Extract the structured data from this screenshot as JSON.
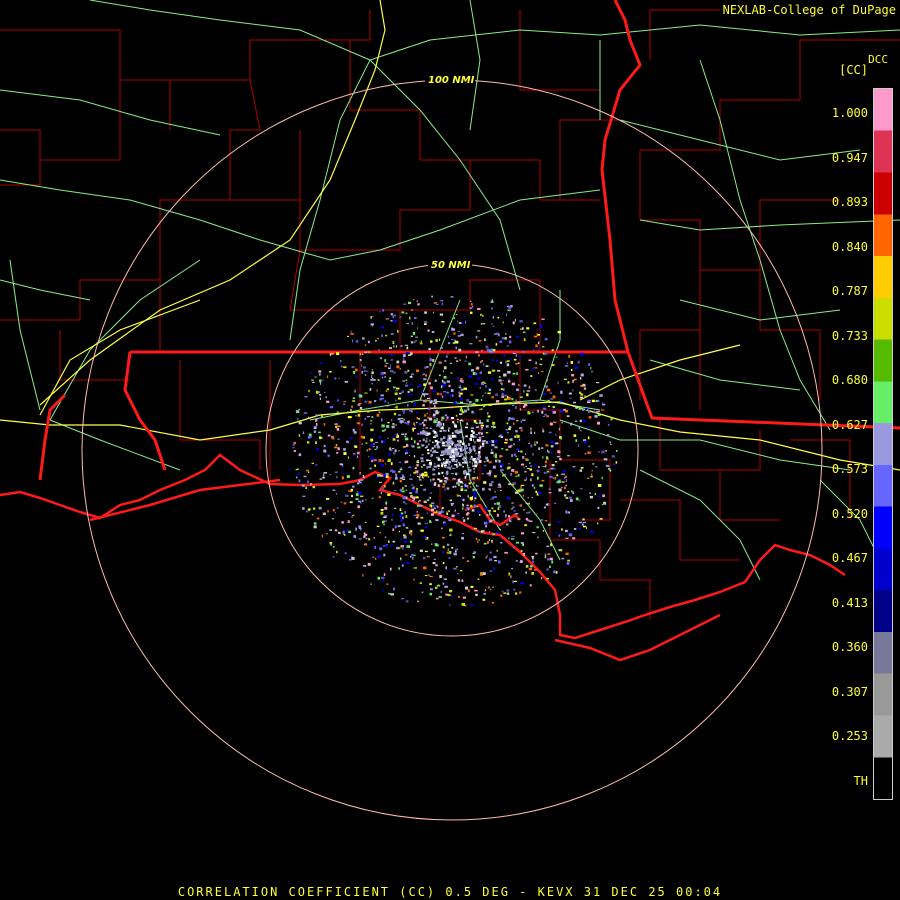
{
  "header": {
    "credit": "NEXLAB-College of DuPage",
    "product_code": "DCC",
    "units": "[CC]"
  },
  "footer": {
    "title": "CORRELATION COEFFICIENT (CC) 0.5 DEG - KEVX 31 DEC 25 00:04"
  },
  "range_rings": [
    {
      "label": "100 NMI"
    },
    {
      "label": "50 NMI"
    }
  ],
  "legend": {
    "labels": [
      "1.000",
      "0.947",
      "0.893",
      "0.840",
      "0.787",
      "0.733",
      "0.680",
      "0.627",
      "0.573",
      "0.520",
      "0.467",
      "0.413",
      "0.360",
      "0.307",
      "0.253",
      "TH"
    ],
    "colors": [
      "#ff99cc",
      "#dd3355",
      "#cc0000",
      "#ff6600",
      "#ffcc00",
      "#ccdd00",
      "#55bb00",
      "#66ee66",
      "#9999dd",
      "#6666ff",
      "#0000ff",
      "#0000cc",
      "#000088",
      "#777799",
      "#999999",
      "#aaaaaa",
      "#000000"
    ]
  },
  "colors": {
    "background": "#000000",
    "state_border": "#ff1a1a",
    "county_border": "#cc0000",
    "highway": "#ffff44",
    "road": "#88ee88",
    "range_ring": "#ffbbaa",
    "text": "#ffff33"
  }
}
